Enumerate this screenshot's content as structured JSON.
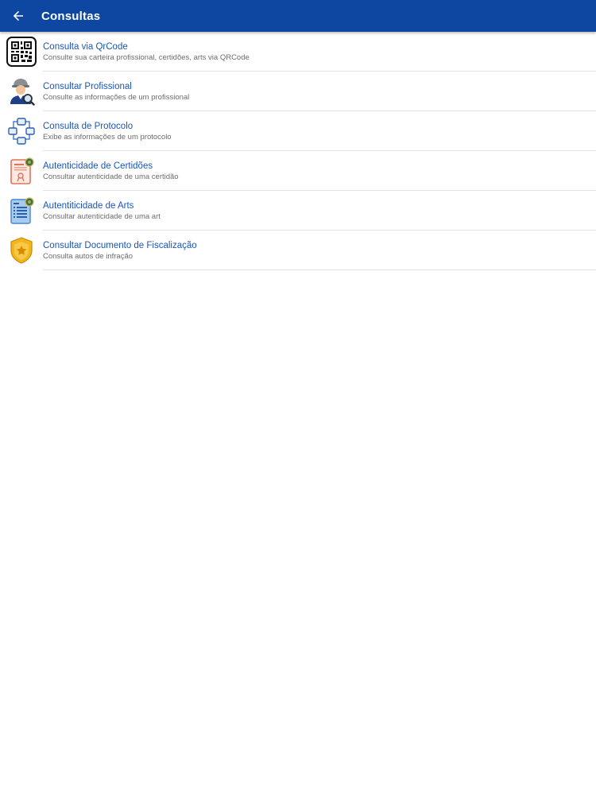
{
  "header": {
    "title": "Consultas",
    "back_icon": "arrow-left-icon",
    "color": "#0d47a1"
  },
  "items": [
    {
      "title": "Consulta via QrCode",
      "subtitle": "Consulte sua carteira profissional, certidões, arts via QRCode",
      "icon": "qr-code-icon"
    },
    {
      "title": "Consultar Profissional",
      "subtitle": "Consulte as informações de um profissional",
      "icon": "professional-search-icon"
    },
    {
      "title": "Consulta de Protocolo",
      "subtitle": "Exibe as informações de um protocolo",
      "icon": "protocol-network-icon"
    },
    {
      "title": "Autenticidade de Certidões",
      "subtitle": "Consultar autenticidade de uma certidão",
      "icon": "certificate-icon"
    },
    {
      "title": "Autentiticidade de Arts",
      "subtitle": "Consultar autenticidade de uma art",
      "icon": "art-document-icon"
    },
    {
      "title": "Consultar Documento de Fiscalização",
      "subtitle": "Consulta autos de infração",
      "icon": "badge-star-icon"
    }
  ]
}
